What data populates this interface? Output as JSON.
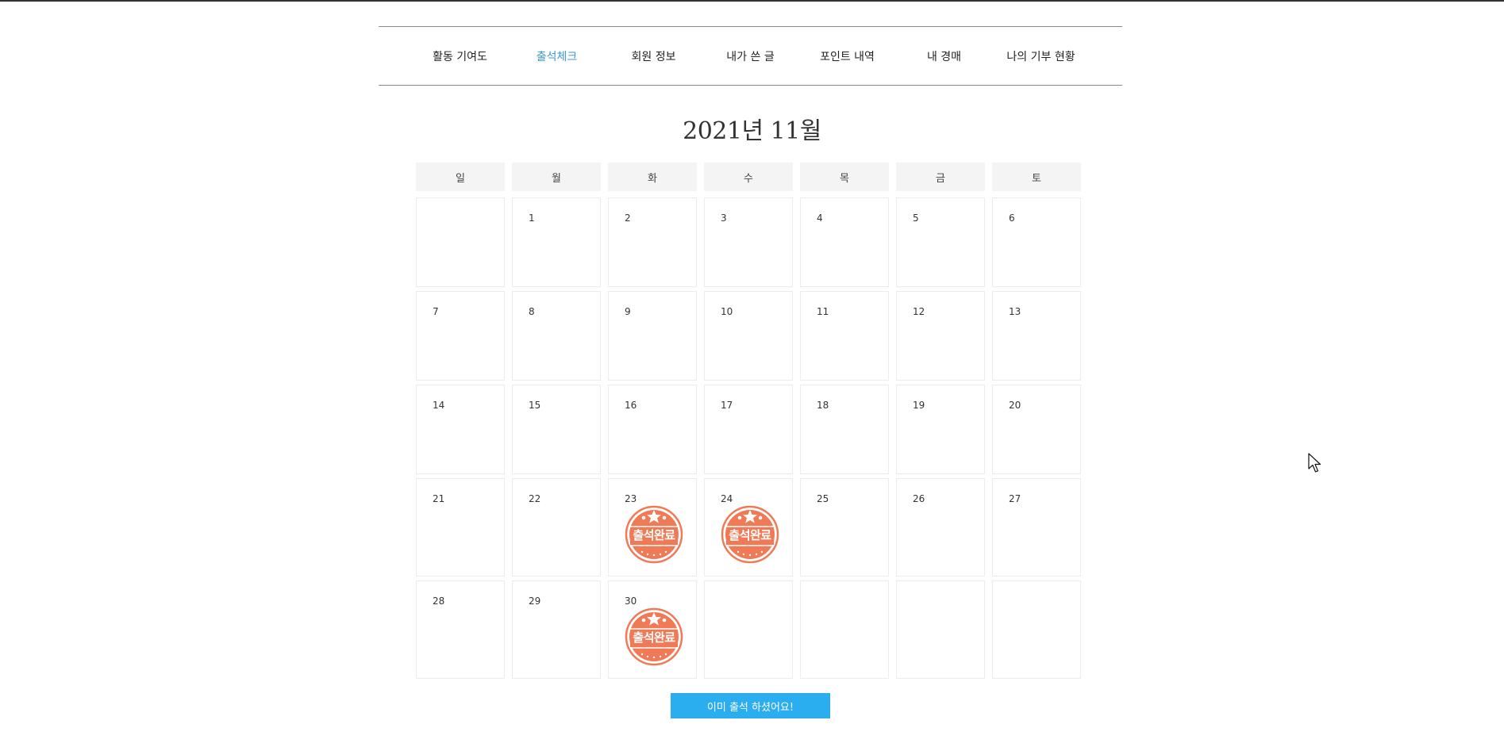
{
  "nav": {
    "items": [
      {
        "label": "활동 기여도",
        "active": false
      },
      {
        "label": "출석체크",
        "active": true
      },
      {
        "label": "회원 정보",
        "active": false
      },
      {
        "label": "내가 쓴 글",
        "active": false
      },
      {
        "label": "포인트 내역",
        "active": false
      },
      {
        "label": "내 경매",
        "active": false
      },
      {
        "label": "나의 기부 현황",
        "active": false
      }
    ]
  },
  "calendar": {
    "title": "2021년 11월",
    "weekdays": [
      "일",
      "월",
      "화",
      "수",
      "목",
      "금",
      "토"
    ],
    "weeks": [
      [
        "",
        "1",
        "2",
        "3",
        "4",
        "5",
        "6"
      ],
      [
        "7",
        "8",
        "9",
        "10",
        "11",
        "12",
        "13"
      ],
      [
        "14",
        "15",
        "16",
        "17",
        "18",
        "19",
        "20"
      ],
      [
        "21",
        "22",
        "23",
        "24",
        "25",
        "26",
        "27"
      ],
      [
        "28",
        "29",
        "30",
        "",
        "",
        "",
        ""
      ]
    ],
    "attended_days": [
      "23",
      "24",
      "30"
    ],
    "stamp_label": "출석완료"
  },
  "button": {
    "label": "이미 출석 하셨어요!"
  },
  "colors": {
    "accent_nav": "#3a9ad9",
    "button": "#2baef0",
    "stamp": "#f07a56"
  }
}
